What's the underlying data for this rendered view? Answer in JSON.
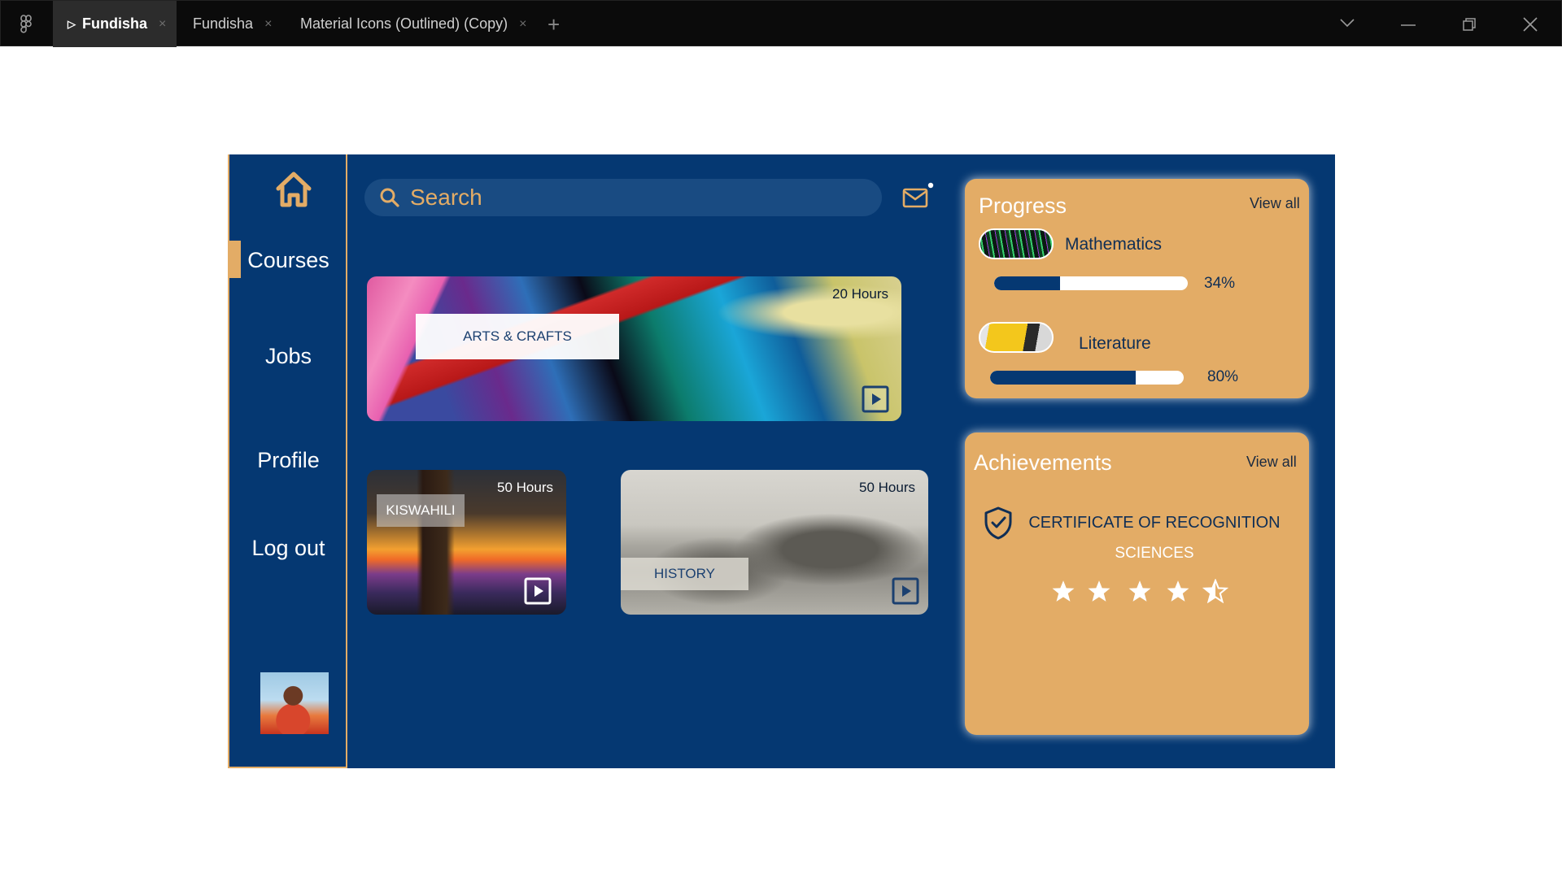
{
  "window": {
    "tabs": [
      {
        "label": "Fundisha",
        "active": true
      },
      {
        "label": "Fundisha",
        "active": false
      },
      {
        "label": "Material Icons (Outlined) (Copy)",
        "active": false
      }
    ],
    "close_glyph": "×",
    "plus_glyph": "+"
  },
  "sidebar": {
    "items": [
      {
        "label": "Courses",
        "active": true
      },
      {
        "label": "Jobs"
      },
      {
        "label": "Profile"
      },
      {
        "label": "Log out"
      }
    ]
  },
  "search": {
    "placeholder": "Search"
  },
  "courses": [
    {
      "title": "ARTS & CRAFTS",
      "hours": "20 Hours"
    },
    {
      "title": "KISWAHILI",
      "hours": "50 Hours"
    },
    {
      "title": "HISTORY",
      "hours": "50 Hours"
    }
  ],
  "progress": {
    "title": "Progress",
    "view_all": "View all",
    "items": [
      {
        "subject": "Mathematics",
        "percent_label": "34%",
        "value": 0.34
      },
      {
        "subject": "Literature",
        "percent_label": "80%",
        "value": 0.75
      }
    ]
  },
  "achievements": {
    "title": "Achievements",
    "view_all": "View all",
    "certificate": "CERTIFICATE OF RECOGNITION",
    "subject": "SCIENCES",
    "rating": 4.5,
    "rating_max": 5
  },
  "colors": {
    "accent": "#e3ac66",
    "navy": "#053872"
  }
}
